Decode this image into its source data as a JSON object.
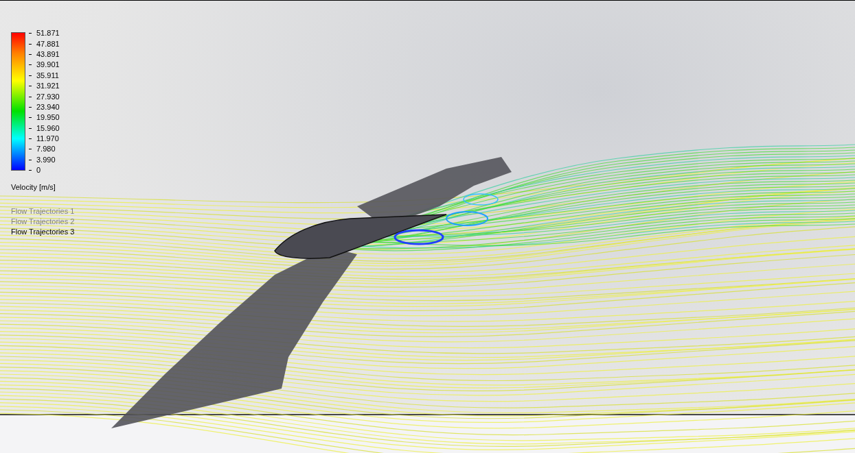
{
  "legend": {
    "ticks": [
      "51.871",
      "47.881",
      "43.891",
      "39.901",
      "35.911",
      "31.921",
      "27.930",
      "23.940",
      "19.950",
      "15.960",
      "11.970",
      "7.980",
      "3.990",
      "0"
    ],
    "title": "Velocity [m/s]"
  },
  "trajectories": [
    {
      "label": "Flow Trajectories 1",
      "selected": false
    },
    {
      "label": "Flow Trajectories 2",
      "selected": false
    },
    {
      "label": "Flow Trajectories 3",
      "selected": true
    }
  ]
}
